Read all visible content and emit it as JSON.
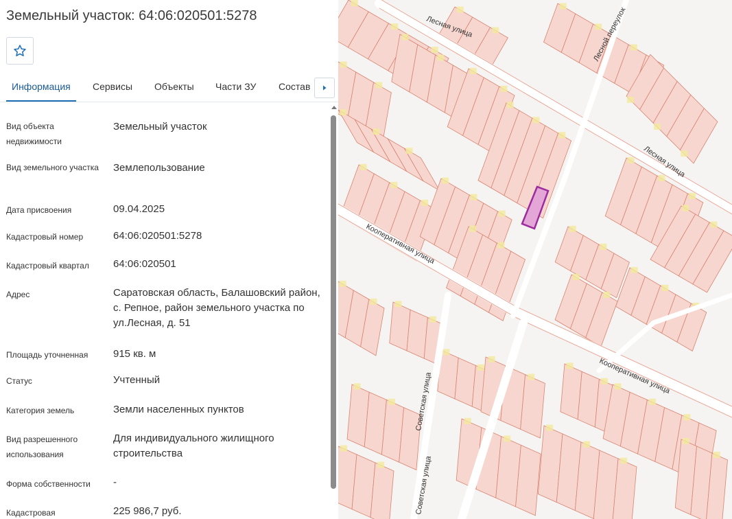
{
  "header": {
    "title": "Земельный участок: 64:06:020501:5278"
  },
  "tabs": [
    {
      "label": "Информация",
      "active": true
    },
    {
      "label": "Сервисы",
      "active": false
    },
    {
      "label": "Объекты",
      "active": false
    },
    {
      "label": "Части ЗУ",
      "active": false
    },
    {
      "label": "Состав",
      "active": false
    }
  ],
  "properties": [
    {
      "label": "Вид объекта недвижимости",
      "value": "Земельный участок"
    },
    {
      "label": "Вид земельного участка",
      "value": "Землепользование"
    },
    {
      "label": "Дата присвоения",
      "value": "09.04.2025"
    },
    {
      "label": "Кадастровый номер",
      "value": "64:06:020501:5278"
    },
    {
      "label": "Кадастровый квартал",
      "value": "64:06:020501"
    },
    {
      "label": "Адрес",
      "value": "Саратовская область, Балашовский район, с. Репное, район земельного участка по ул.Лесная, д. 51"
    },
    {
      "label": "Площадь уточненная",
      "value": "915 кв. м"
    },
    {
      "label": "Статус",
      "value": "Учтенный"
    },
    {
      "label": "Категория земель",
      "value": "Земли населенных пунктов"
    },
    {
      "label": "Вид разрешенного использования",
      "value": "Для индивидуального жилищного строительства"
    },
    {
      "label": "Форма собственности",
      "value": "-"
    },
    {
      "label": "Кадастровая",
      "value": "225 986,7 руб."
    }
  ],
  "map": {
    "streets": {
      "lesnaya_top": "Лесная улица",
      "lesnaya_right": "Лесная улица",
      "lesnoy_per": "Лесной переулок",
      "kooperativnaya_left": "Кооперативная улица",
      "kooperativnaya_right": "Кооперативная улица",
      "sovetskaya_1": "Советская улица",
      "sovetskaya_2": "Советская улица"
    },
    "colors": {
      "parcel_fill": "#f6d6cf",
      "parcel_stroke": "#d98470",
      "selected_fill": "#e3a6d6",
      "selected_stroke": "#9b2c9e",
      "road": "#ffffff",
      "building": "#f2ea9c"
    }
  },
  "icons": {
    "favorite": "star-outline-icon",
    "next": "chevron-right-icon"
  }
}
